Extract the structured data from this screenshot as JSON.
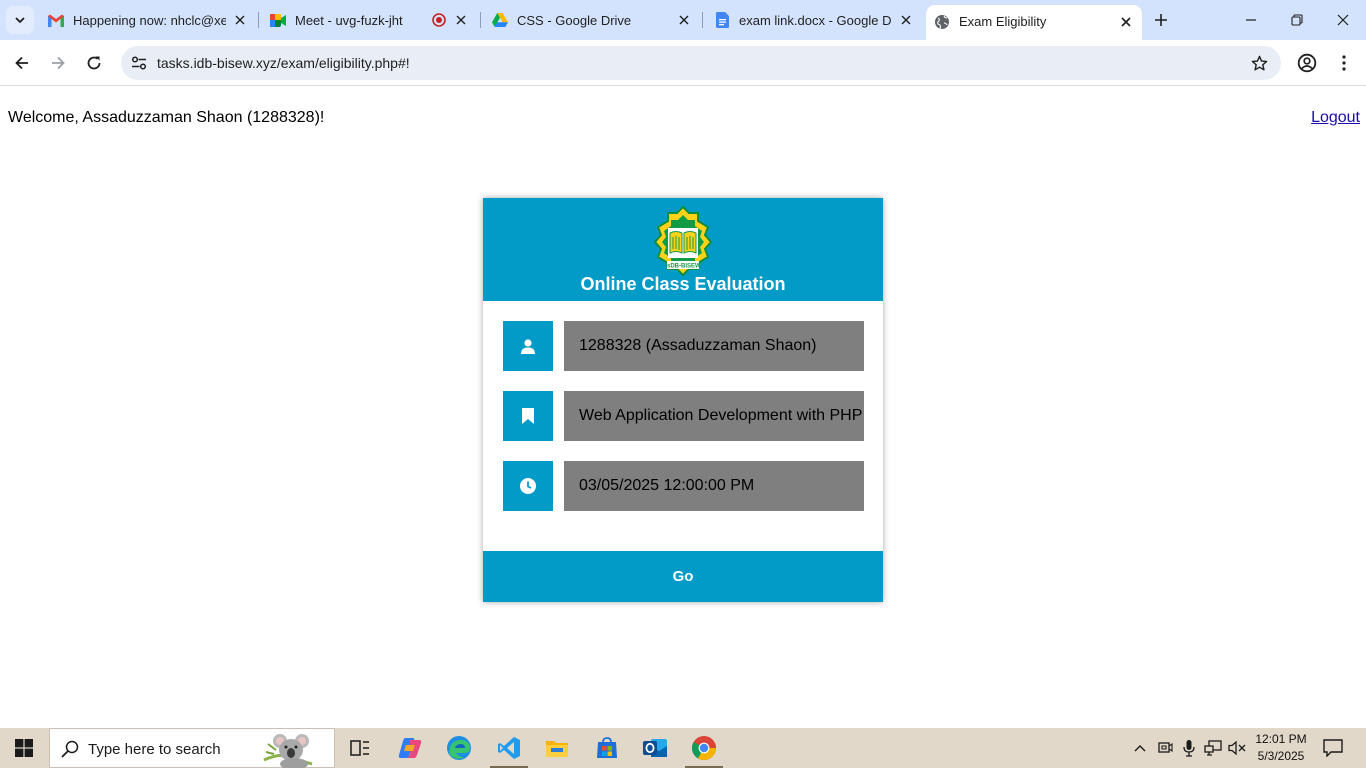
{
  "browser": {
    "tabs": [
      {
        "title": "Happening now: nhclc@xeou",
        "icon": "gmail-icon",
        "active": false
      },
      {
        "title": "Meet - uvg-fuzk-jht",
        "icon": "meet-icon",
        "active": false
      },
      {
        "title": "CSS - Google Drive",
        "icon": "drive-icon",
        "active": false
      },
      {
        "title": "exam link.docx - Google Docs",
        "icon": "docs-icon",
        "active": false
      },
      {
        "title": "Exam Eligibility",
        "icon": "globe-icon",
        "active": true
      }
    ],
    "url": "tasks.idb-bisew.xyz/exam/eligibility.php#!"
  },
  "page": {
    "welcome_text": "Welcome, Assaduzzaman Shaon (1288328)!",
    "logout_label": "Logout",
    "card": {
      "title": "Online Class Evaluation",
      "logo_text": "IsDB-BISEW",
      "fields": [
        {
          "icon": "user-icon",
          "value": "1288328 (Assaduzzaman Shaon)"
        },
        {
          "icon": "bookmark-icon",
          "value": "Web Application Development with PHP"
        },
        {
          "icon": "clock-icon",
          "value": "03/05/2025 12:00:00 PM"
        }
      ],
      "go_label": "Go"
    },
    "colors": {
      "accent": "#029ac7",
      "field_bg": "#7f7f7f"
    }
  },
  "taskbar": {
    "search_placeholder": "Type here to search",
    "apps": [
      "task-view-icon",
      "copilot-icon",
      "edge-icon",
      "vscode-icon",
      "file-explorer-icon",
      "store-icon",
      "outlook-icon",
      "chrome-icon"
    ],
    "time": "12:01 PM",
    "date": "5/3/2025"
  }
}
